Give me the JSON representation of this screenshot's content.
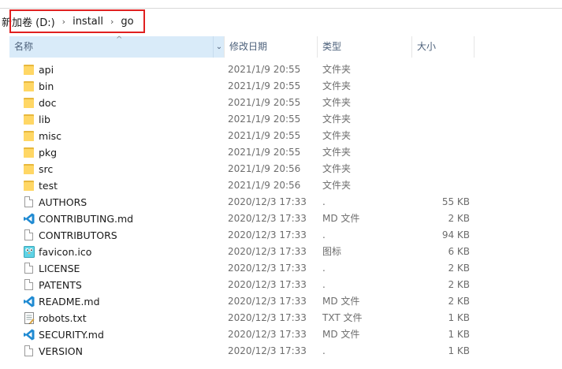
{
  "breadcrumb": {
    "items": [
      "新加卷 (D:)",
      "install",
      "go"
    ],
    "separator": "›"
  },
  "columns": {
    "name": "名称",
    "date": "修改日期",
    "type": "类型",
    "size": "大小",
    "sort_indicator": "^",
    "dropdown": "⌄"
  },
  "colors": {
    "highlight_border": "#e02020",
    "header_selected": "#d9ebf9",
    "folder": "#ffd765",
    "vscode_blue": "#1f8ad2"
  },
  "files": [
    {
      "name": "api",
      "date": "2021/1/9 20:55",
      "type": "文件夹",
      "size": "",
      "icon": "folder-icon"
    },
    {
      "name": "bin",
      "date": "2021/1/9 20:55",
      "type": "文件夹",
      "size": "",
      "icon": "folder-icon"
    },
    {
      "name": "doc",
      "date": "2021/1/9 20:55",
      "type": "文件夹",
      "size": "",
      "icon": "folder-icon"
    },
    {
      "name": "lib",
      "date": "2021/1/9 20:55",
      "type": "文件夹",
      "size": "",
      "icon": "folder-icon"
    },
    {
      "name": "misc",
      "date": "2021/1/9 20:55",
      "type": "文件夹",
      "size": "",
      "icon": "folder-icon"
    },
    {
      "name": "pkg",
      "date": "2021/1/9 20:55",
      "type": "文件夹",
      "size": "",
      "icon": "folder-icon"
    },
    {
      "name": "src",
      "date": "2021/1/9 20:56",
      "type": "文件夹",
      "size": "",
      "icon": "folder-icon"
    },
    {
      "name": "test",
      "date": "2021/1/9 20:56",
      "type": "文件夹",
      "size": "",
      "icon": "folder-icon"
    },
    {
      "name": "AUTHORS",
      "date": "2020/12/3 17:33",
      "type": ".",
      "size": "55 KB",
      "icon": "file-icon"
    },
    {
      "name": "CONTRIBUTING.md",
      "date": "2020/12/3 17:33",
      "type": "MD 文件",
      "size": "2 KB",
      "icon": "vscode-file-icon"
    },
    {
      "name": "CONTRIBUTORS",
      "date": "2020/12/3 17:33",
      "type": ".",
      "size": "94 KB",
      "icon": "file-icon"
    },
    {
      "name": "favicon.ico",
      "date": "2020/12/3 17:33",
      "type": "图标",
      "size": "6 KB",
      "icon": "gopher-icon"
    },
    {
      "name": "LICENSE",
      "date": "2020/12/3 17:33",
      "type": ".",
      "size": "2 KB",
      "icon": "file-icon"
    },
    {
      "name": "PATENTS",
      "date": "2020/12/3 17:33",
      "type": ".",
      "size": "2 KB",
      "icon": "file-icon"
    },
    {
      "name": "README.md",
      "date": "2020/12/3 17:33",
      "type": "MD 文件",
      "size": "2 KB",
      "icon": "vscode-file-icon"
    },
    {
      "name": "robots.txt",
      "date": "2020/12/3 17:33",
      "type": "TXT 文件",
      "size": "1 KB",
      "icon": "text-file-icon"
    },
    {
      "name": "SECURITY.md",
      "date": "2020/12/3 17:33",
      "type": "MD 文件",
      "size": "1 KB",
      "icon": "vscode-file-icon"
    },
    {
      "name": "VERSION",
      "date": "2020/12/3 17:33",
      "type": ".",
      "size": "1 KB",
      "icon": "file-icon"
    }
  ]
}
